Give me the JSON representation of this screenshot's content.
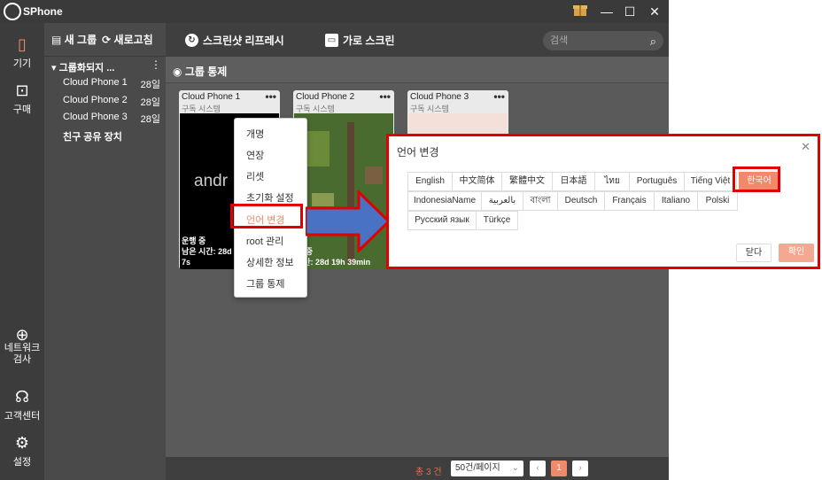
{
  "app": {
    "title": "SPhone"
  },
  "sidebar": {
    "items": [
      {
        "label": "기기",
        "icon": "device-icon"
      },
      {
        "label": "구매",
        "icon": "cart-icon"
      },
      {
        "label": "네트워크\n검사",
        "icon": "globe-icon"
      },
      {
        "label": "고객센터",
        "icon": "headset-icon"
      },
      {
        "label": "설정",
        "icon": "gear-icon"
      }
    ]
  },
  "groups": {
    "new_group": "새 그룹",
    "refresh": "새로고침",
    "group_name": "그룹화되지 ...",
    "phones": [
      {
        "name": "Cloud Phone 1",
        "days": "28일"
      },
      {
        "name": "Cloud Phone 2",
        "days": "28일"
      },
      {
        "name": "Cloud Phone 3",
        "days": "28일"
      }
    ],
    "friend_share": "친구 공유 장치"
  },
  "toolbar": {
    "screenshot_refresh": "스크린샷 리프레시",
    "landscape": "가로 스크린",
    "search_placeholder": "검색"
  },
  "group_control": "그룹 통제",
  "cards": [
    {
      "name": "Cloud Phone 1",
      "sub": "구독 시스템",
      "status": "운행 중",
      "remaining": "남은 시간: 28d",
      "extra": "7s",
      "screen_text": "andr"
    },
    {
      "name": "Cloud Phone 2",
      "sub": "구독 시스템",
      "status": "행 중",
      "remaining": "시간: 28d 19h 39min"
    },
    {
      "name": "Cloud Phone 3",
      "sub": "구독 시스템"
    }
  ],
  "context_menu": [
    "개명",
    "연장",
    "리셋",
    "초기화 설정",
    "언어 변경",
    "root 관리",
    "상세한 정보",
    "그룹 통제"
  ],
  "dialog": {
    "title": "언어 변경",
    "languages_row1": [
      "English",
      "中文简体",
      "繁體中文",
      "日本語",
      "ไทย",
      "Português",
      "Tiếng Việt",
      "한국어"
    ],
    "languages_row2": [
      "IndonesiaName",
      "بالعربية",
      "বাংলা",
      "Deutsch",
      "Français",
      "Italiano",
      "Polski"
    ],
    "languages_row3": [
      "Русский язык",
      "Türkçe"
    ],
    "selected": "한국어",
    "close_label": "닫다",
    "confirm_label": "확인"
  },
  "footer": {
    "total": "총 3 건",
    "page_size": "50건/페이지",
    "current_page": "1"
  },
  "colors": {
    "accent": "#f08a6a",
    "highlight": "#e00000",
    "arrow": "#4a72c4"
  }
}
